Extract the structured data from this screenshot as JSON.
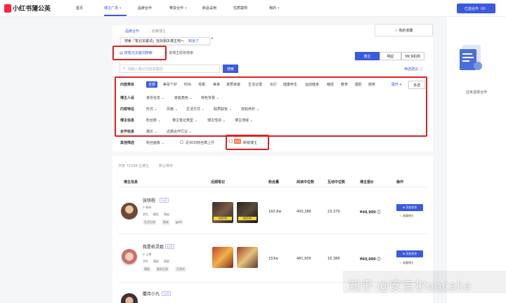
{
  "app": {
    "logo_text": "小红书蒲公英",
    "brand_color": "#ff2442",
    "accent": "#3b5bdb"
  },
  "nav": {
    "items": [
      {
        "label": "首页"
      },
      {
        "label": "博主广场",
        "caret": "▾"
      },
      {
        "label": "品牌合作"
      },
      {
        "label": "带货合作",
        "caret": "▾"
      },
      {
        "label": "新品试用"
      },
      {
        "label": "优质案例"
      },
      {
        "label": "我的",
        "caret": "▾"
      }
    ],
    "selected_button": "已选合作（0）"
  },
  "right_panel": {
    "empty_text": "还未选择合作"
  },
  "tabs": {
    "tab1": "品牌合作",
    "tab2": "收藏博主",
    "favorites": "☆ 我的收藏"
  },
  "tooltip": {
    "text": "搜索「笔记关键词」找找相关博主吧～",
    "action": "知道了",
    "close": "×"
  },
  "search": {
    "mode1": "按笔记关键词搜索",
    "mode2": "按博主昵称搜索",
    "placeholder": "请输入笔记内容关键词",
    "button": "搜索",
    "segments": [
      "博主",
      "明星",
      "MCN机构"
    ],
    "tips": "筛选建议"
  },
  "filters": {
    "content_category": {
      "label": "内容类目",
      "chips": [
        "全部",
        "美妆个护",
        "时尚",
        "母婴",
        "美食",
        "家居家装",
        "生活记录",
        "出行",
        "健康养生",
        "运动健身",
        "萌娃",
        "教育",
        "摄影",
        "搞笑"
      ],
      "collapse": "展开 ▾",
      "multi": "多选"
    },
    "blogger_entry": {
      "label": "博主人设",
      "options": [
        "身份信息",
        "家庭角色",
        "特色背景"
      ]
    },
    "content_feature": {
      "label": "内容特征",
      "options": [
        "形式",
        "风格",
        "生活方式",
        "肤质肤色",
        "皮肤养护"
      ]
    },
    "blogger_info": {
      "label": "博主信息",
      "options": [
        "粉丝数",
        "博主笔记类型",
        "博主性别",
        "博主地域"
      ]
    },
    "cooperation_info": {
      "label": "合作信息",
      "options": [
        "报价",
        "近期合作行业"
      ]
    },
    "other": {
      "label": "其他筛选",
      "options": [
        "粉丝画像"
      ],
      "check1": "近30日粉丝数上升",
      "new_tag": "新锐",
      "check2": "新锐博主"
    }
  },
  "list": {
    "count_text": "共有 72198 位博主",
    "sort_text": "默认排序",
    "headers": [
      "博主信息",
      "近期笔记",
      "粉丝量",
      "阅读中位数",
      "互动中位数",
      "博主报价",
      "操作"
    ],
    "rows": [
      {
        "name": "张铁程",
        "level": "Lv2",
        "location": "杭州",
        "tags": [
          "学生",
          "情侣",
          "萌娃"
        ],
        "tag_boxes": [
          "生活记录",
          "搞笑",
          "gold"
        ],
        "thumb_caps": [
          "情侣日常",
          "搞笑日常"
        ],
        "fans": "160.8w",
        "read_median": "400,388",
        "interact_median": "23,379",
        "price": "¥48,900",
        "add": "⊕ 添加合作",
        "collect": "☆ 收藏博主"
      },
      {
        "name": "我是机灵姐",
        "level": "Lv4",
        "location": "上海",
        "tags": [
          "学生",
          "萌娃",
          "家庭"
        ],
        "tag_boxes": [
          "萌娃",
          "真实记录",
          "沉浸式"
        ],
        "thumb_caps": [
          "",
          ""
        ],
        "fans": "153w",
        "read_median": "481,956",
        "interact_median": "16,386",
        "price": "¥60,000",
        "add": "⊕ 添加合作",
        "collect": "☆ 收藏博主"
      },
      {
        "name": "蘑月小九",
        "level": "Lv3"
      }
    ]
  },
  "watermark": "知乎 @安吉尔oncake"
}
